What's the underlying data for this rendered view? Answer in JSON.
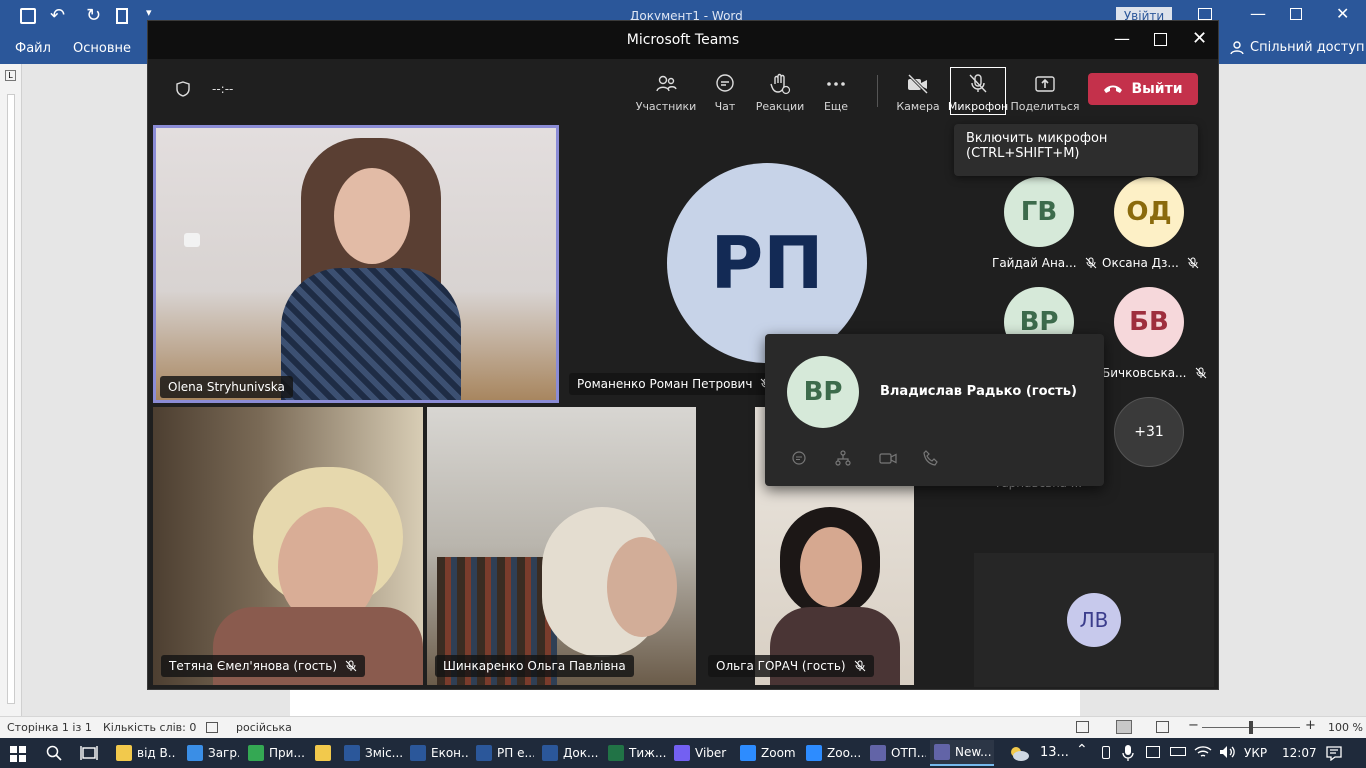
{
  "word": {
    "title": "Документ1  -  Word",
    "login_label": "Увійти",
    "ribbon": {
      "file": "Файл",
      "home": "Основне",
      "share": "Спільний доступ"
    },
    "status": {
      "page": "Сторінка 1 із 1",
      "words": "Кількість слів: 0",
      "language": "російська",
      "zoom": "100 %"
    }
  },
  "teams": {
    "window_title": "Microsoft Teams",
    "timer": "--:--",
    "toolbar": {
      "participants": "Участники",
      "chat": "Чат",
      "reactions": "Реакции",
      "more": "Еще",
      "camera": "Камера",
      "mic": "Микрофон",
      "share": "Поделиться",
      "leave": "Выйти"
    },
    "tooltip": {
      "line1": "Включить микрофон",
      "line2": "(CTRL+SHIFT+M)"
    },
    "tiles": [
      {
        "name": "Olena Stryhunivska"
      },
      {
        "name": "Романенко Роман Петрович",
        "initials": "РП"
      },
      {
        "name": "Тетяна Ємел'янова (гость)"
      },
      {
        "name": "Шинкаренко Ольга Павлівна"
      },
      {
        "name": "Ольга ГОРАЧ (гость)"
      }
    ],
    "side": [
      {
        "initials": "ГВ",
        "name": "Гайдай Ана...",
        "bg": "#d6e9d9",
        "fg": "#3d6b4c"
      },
      {
        "initials": "ОД",
        "name": "Оксана Дз...",
        "bg": "#fdf0c6",
        "fg": "#8a6a0c"
      },
      {
        "initials": "ВР",
        "name": "",
        "bg": "#d6e9d9",
        "fg": "#3d6b4c"
      },
      {
        "initials": "БВ",
        "name": "Бичковська...",
        "bg": "#f6d8db",
        "fg": "#9e2e3d"
      },
      {
        "initials": "",
        "name": "Тарнавська ...",
        "bg": "#3a3a3a",
        "fg": "#fff"
      },
      {
        "initials": "+31",
        "name": "",
        "bg": "#3a3a3a",
        "fg": "#fff"
      }
    ],
    "popup": {
      "initials": "ВР",
      "name": "Владислав Радько (гость)"
    },
    "bottom_avatar": {
      "initials": "ЛВ"
    }
  },
  "taskbar": {
    "items": [
      {
        "label": "від В...",
        "color": "#f2c94c"
      },
      {
        "label": "Загр...",
        "color": "#3a8ee6"
      },
      {
        "label": "При...",
        "color": "#34a853"
      },
      {
        "label": "",
        "color": "#f2c94c"
      },
      {
        "label": "Зміс...",
        "color": "#2b579a"
      },
      {
        "label": "Екон...",
        "color": "#2b579a"
      },
      {
        "label": "РП е...",
        "color": "#2b579a"
      },
      {
        "label": "Док...",
        "color": "#2b579a"
      },
      {
        "label": "Тиж...",
        "color": "#217346"
      },
      {
        "label": "Viber",
        "color": "#7360f2"
      },
      {
        "label": "Zoom",
        "color": "#2d8cff"
      },
      {
        "label": "Zoo...",
        "color": "#2d8cff"
      },
      {
        "label": "ОТП...",
        "color": "#6264a7"
      },
      {
        "label": "New...",
        "color": "#6264a7"
      }
    ],
    "weather": "13...",
    "lang": "УКР",
    "time": "12:07"
  }
}
